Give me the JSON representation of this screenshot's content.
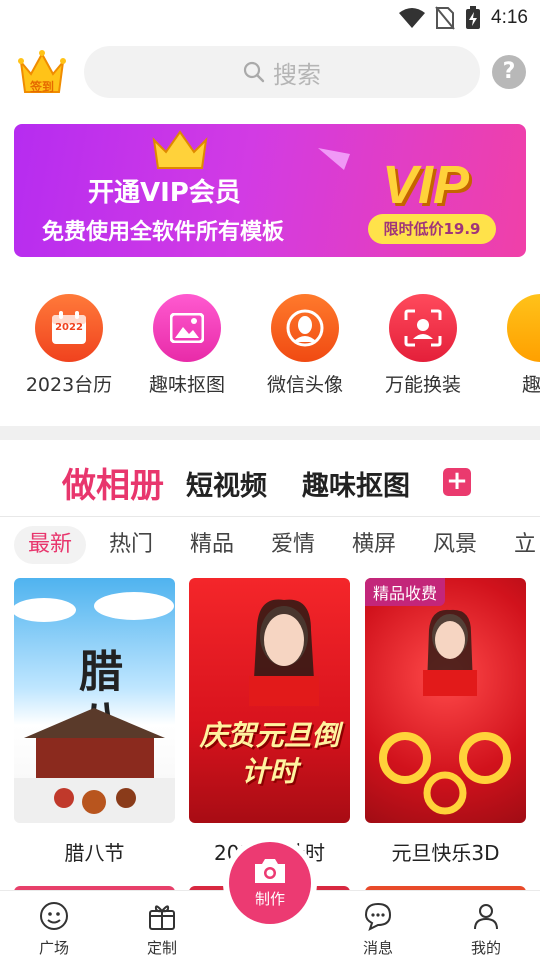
{
  "status_bar": {
    "time": "4:16"
  },
  "topbar": {
    "signin_label": "签到",
    "search_placeholder": "搜索",
    "help_label": "?"
  },
  "banner": {
    "title": "开通VIP会员",
    "subtitle": "免费使用全软件所有模板",
    "vip_text": "VIP",
    "price_tag": "限时低价19.9"
  },
  "shortcuts": [
    {
      "label": "2023台历",
      "icon": "calendar-icon",
      "color": "#ff5a2c",
      "badge": "2022"
    },
    {
      "label": "趣味抠图",
      "icon": "image-icon",
      "color": "#f23fb8"
    },
    {
      "label": "微信头像",
      "icon": "avatar-icon",
      "color": "#ff5a1f"
    },
    {
      "label": "万能换装",
      "icon": "face-scan-icon",
      "color": "#f2334a"
    },
    {
      "label": "趣味",
      "icon": "more-icon",
      "color": "#ffb300"
    }
  ],
  "category_tabs": [
    "做相册",
    "短视频",
    "趣味抠图"
  ],
  "sub_tabs": [
    "最新",
    "热门",
    "精品",
    "爱情",
    "横屏",
    "风景",
    "立"
  ],
  "cards": [
    {
      "title": "腊八节",
      "image_text": "腊八",
      "badge": ""
    },
    {
      "title": "2023倒计时",
      "image_text": "庆贺元旦倒计时",
      "badge": ""
    },
    {
      "title": "元旦快乐3D",
      "image_text": "",
      "badge": "精品收费"
    }
  ],
  "bottom_nav": {
    "items": [
      {
        "label": "广场",
        "icon": "plaza-icon"
      },
      {
        "label": "定制",
        "icon": "gift-icon"
      },
      {
        "label": "消息",
        "icon": "message-icon"
      },
      {
        "label": "我的",
        "icon": "profile-icon"
      }
    ],
    "make_label": "制作"
  },
  "colors": {
    "accent": "#e8366d",
    "banner_start": "#b62cf0",
    "banner_end": "#f040a8"
  }
}
